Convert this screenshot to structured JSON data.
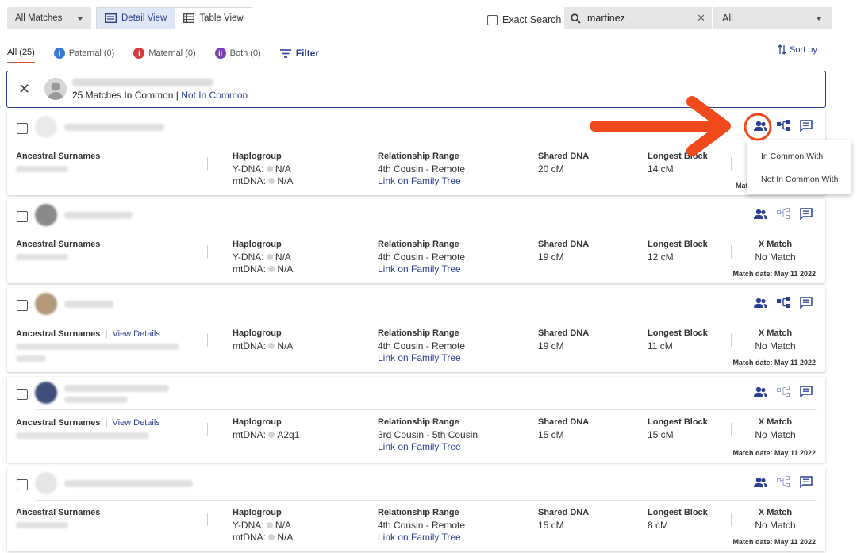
{
  "toolbar": {
    "matches_filter": "All Matches",
    "detail_view": "Detail View",
    "table_view": "Table View",
    "exact_search": "Exact Search",
    "search_value": "martinez",
    "search_scope": "All"
  },
  "tabs": {
    "all": "All (25)",
    "paternal": "Paternal (0)",
    "maternal": "Maternal (0)",
    "both": "Both (0)",
    "filter": "Filter",
    "sort": "Sort by"
  },
  "banner": {
    "matches_in_common": "25 Matches In Common",
    "separator": " | ",
    "not_in_common": "Not In Common"
  },
  "labels": {
    "ancestral_surnames": "Ancestral Surnames",
    "view_details": "View Details",
    "haplogroup": "Haplogroup",
    "ydna": "Y-DNA:",
    "mtdna": "mtDNA:",
    "relationship_range": "Relationship Range",
    "link_family_tree": "Link on Family Tree",
    "shared_dna": "Shared DNA",
    "longest_block": "Longest Block",
    "x_match": "X Match"
  },
  "popup": {
    "in_common_with": "In Common With",
    "not_in_common_with": "Not In Common With"
  },
  "cards": [
    {
      "ydna": "N/A",
      "mtdna": "N/A",
      "relationship": "4th Cousin - Remote",
      "shared_dna": "20 cM",
      "longest_block": "14 cM",
      "x_match": "",
      "match_date": "Matc"
    },
    {
      "ydna": "N/A",
      "mtdna": "N/A",
      "relationship": "4th Cousin - Remote",
      "shared_dna": "19 cM",
      "longest_block": "12 cM",
      "x_match": "No Match",
      "match_date": "Match date: May 11 2022"
    },
    {
      "mtdna": "N/A",
      "relationship": "4th Cousin - Remote",
      "shared_dna": "19 cM",
      "longest_block": "11 cM",
      "x_match": "No Match",
      "match_date": "Match date: May 11 2022"
    },
    {
      "mtdna": "A2q1",
      "relationship": "3rd Cousin - 5th Cousin",
      "shared_dna": "15 cM",
      "longest_block": "15 cM",
      "x_match": "No Match",
      "match_date": "Match date: May 11 2022"
    },
    {
      "ydna": "N/A",
      "mtdna": "N/A",
      "relationship": "4th Cousin - Remote",
      "shared_dna": "15 cM",
      "longest_block": "8 cM",
      "x_match": "No Match",
      "match_date": "Match date: May 11 2022"
    }
  ],
  "colors": {
    "brand_blue": "#2d3f91",
    "annotation_orange": "#f04a1c",
    "paternal": "#3b7bd6",
    "maternal": "#d43b3b",
    "both": "#7b3fb5"
  }
}
